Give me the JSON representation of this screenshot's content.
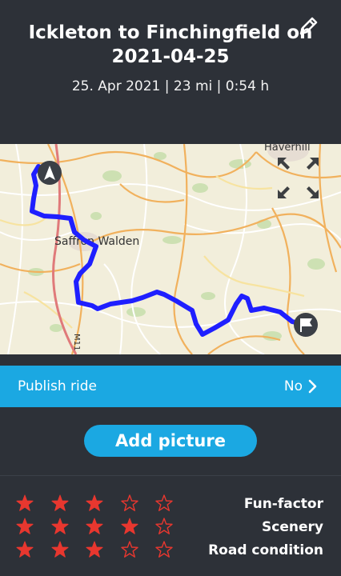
{
  "ride": {
    "title_line1": "Ickleton to Finchingfield on",
    "title_line2": "2021-04-25",
    "summary": "25. Apr 2021 | 23 mi | 0:54 h"
  },
  "map": {
    "labels": {
      "haverhill": "Haverhill",
      "saffron_walden": "Saffron Walden",
      "m11": "M11"
    },
    "route_color": "#1f1fff"
  },
  "publish": {
    "label": "Publish ride",
    "value": "No"
  },
  "add_picture": {
    "label": "Add picture"
  },
  "ratings": [
    {
      "label": "Fun-factor",
      "value": 3,
      "max": 5
    },
    {
      "label": "Scenery",
      "value": 4,
      "max": 5
    },
    {
      "label": "Road condition",
      "value": 3,
      "max": 5
    }
  ],
  "colors": {
    "background": "#2d3138",
    "accent": "#1ba8e2",
    "star": "#e8372f"
  }
}
